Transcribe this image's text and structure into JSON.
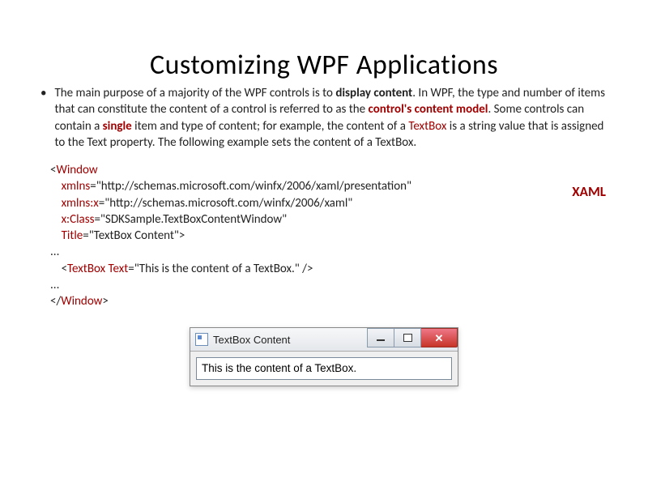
{
  "title": "Customizing WPF Applications",
  "para": {
    "t1": "The main purpose of a majority of the WPF controls is to ",
    "b1": "display content",
    "t2": ". In WPF, the type and number of items that can constitute the content of a control is referred to as the ",
    "b2": "control's content model",
    "t3": ". Some controls can contain a ",
    "b3": "single",
    "t4": " item and type of content; for example, the content of a ",
    "b4": "TextBox",
    "t5": " is a string value that is assigned to the Text property. The following example sets the content of a TextBox."
  },
  "code": {
    "l1a": "<",
    "l1b": "Window",
    "l2a": "    xmlns",
    "l2b": "=\"http://schemas.microsoft.com/winfx/2006/xaml/presentation\"",
    "l3a": "    xmlns:x",
    "l3b": "=\"http://schemas.microsoft.com/winfx/2006/xaml\"",
    "l4a": "    x:Class",
    "l4b": "=\"SDKSample.TextBoxContentWindow\"",
    "l5a": "    Title",
    "l5b": "=\"TextBox Content\">",
    "l6": "...",
    "l7a": "    <",
    "l7b": "TextBox",
    "l7c": " Text",
    "l7d": "=\"This is the content of a TextBox.\" />",
    "l8": "...",
    "l9a": "</",
    "l9b": "Window",
    "l9c": ">"
  },
  "xaml_label": "XAML",
  "window": {
    "title": "TextBox Content",
    "textbox_value": "This is the content of a TextBox."
  }
}
